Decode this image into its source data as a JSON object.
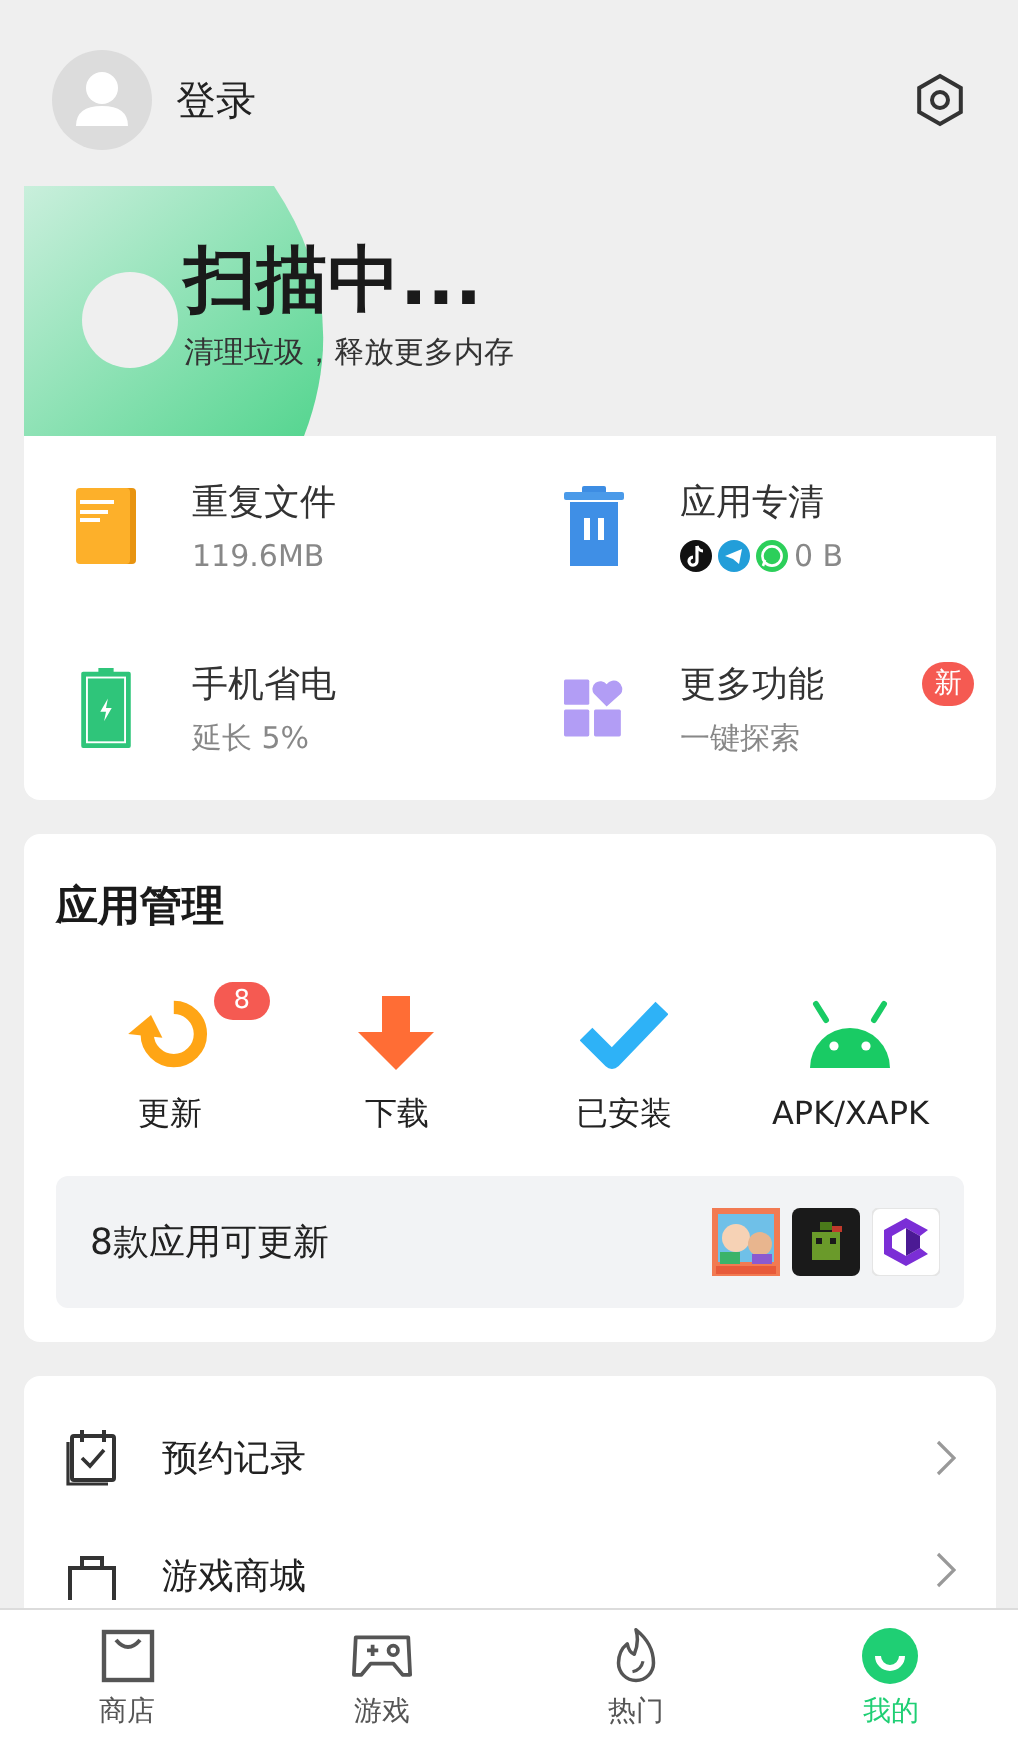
{
  "header": {
    "login": "登录"
  },
  "banner": {
    "title": "扫描中...",
    "subtitle": "清理垃圾，释放更多内存"
  },
  "tools": [
    {
      "kind": "file",
      "title": "重复文件",
      "subtitle": "119.6MB"
    },
    {
      "kind": "apps",
      "title": "应用专清",
      "subtitle": "0 B"
    },
    {
      "kind": "battery",
      "title": "手机省电",
      "subtitle": "延长 5%"
    },
    {
      "kind": "more",
      "title": "更多功能",
      "subtitle": "一键探索",
      "badge": "新"
    }
  ],
  "app_management": {
    "title": "应用管理",
    "items": [
      {
        "kind": "update",
        "label": "更新",
        "badge": "8"
      },
      {
        "kind": "download",
        "label": "下载"
      },
      {
        "kind": "installed",
        "label": "已安装"
      },
      {
        "kind": "apk",
        "label": "APK/XAPK"
      }
    ],
    "update_notice": "8款应用可更新"
  },
  "menu": [
    {
      "kind": "booking",
      "label": "预约记录"
    },
    {
      "kind": "shop",
      "label": "游戏商城"
    }
  ],
  "nav": [
    {
      "kind": "store",
      "label": "商店",
      "selected": false
    },
    {
      "kind": "games",
      "label": "游戏",
      "selected": false
    },
    {
      "kind": "hot",
      "label": "热门",
      "selected": false
    },
    {
      "kind": "me",
      "label": "我的",
      "selected": true
    }
  ]
}
